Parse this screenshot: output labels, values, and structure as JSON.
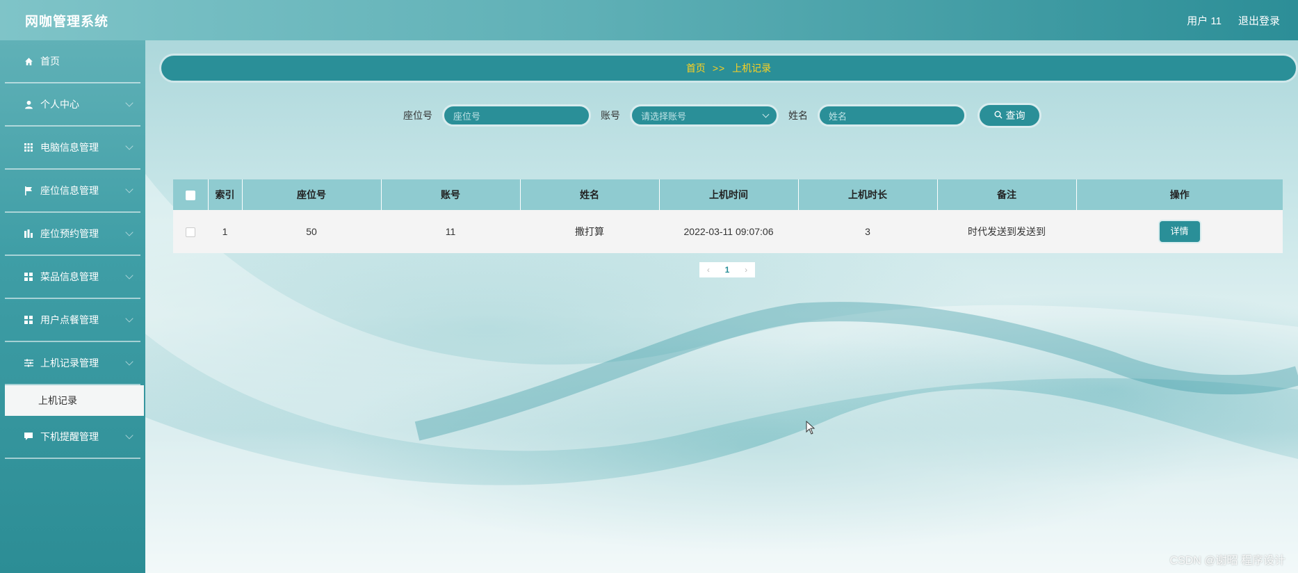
{
  "app": {
    "title": "网咖管理系统"
  },
  "header": {
    "user": "用户 11",
    "logout": "退出登录"
  },
  "sidebar": {
    "items": [
      {
        "label": "首页",
        "icon": "home-icon"
      },
      {
        "label": "个人中心",
        "icon": "user-icon"
      },
      {
        "label": "电脑信息管理",
        "icon": "grid-icon"
      },
      {
        "label": "座位信息管理",
        "icon": "flag-icon"
      },
      {
        "label": "座位预约管理",
        "icon": "chart-icon"
      },
      {
        "label": "菜品信息管理",
        "icon": "apps-icon"
      },
      {
        "label": "用户点餐管理",
        "icon": "apps-icon"
      },
      {
        "label": "上机记录管理",
        "icon": "sliders-icon"
      }
    ],
    "active_sub": "上机记录",
    "last_item": {
      "label": "下机提醒管理",
      "icon": "message-icon"
    }
  },
  "breadcrumb": {
    "home": "首页",
    "separator": ">>",
    "current": "上机记录"
  },
  "search": {
    "seat_label": "座位号",
    "seat_placeholder": "座位号",
    "account_label": "账号",
    "account_placeholder": "请选择账号",
    "name_label": "姓名",
    "name_placeholder": "姓名",
    "button": "查询"
  },
  "table": {
    "headers": [
      "索引",
      "座位号",
      "账号",
      "姓名",
      "上机时间",
      "上机时长",
      "备注",
      "操作"
    ],
    "rows": [
      {
        "index": "1",
        "seat": "50",
        "account": "11",
        "name": "撒打算",
        "time": "2022-03-11 09:07:06",
        "duration": "3",
        "note": "时代发送到发送到",
        "action": "详情"
      }
    ]
  },
  "pagination": {
    "current": "1"
  },
  "watermark": "CSDN @谢昭 程序设计",
  "colors": {
    "primary": "#2a8f98",
    "breadcrumb_text": "#ffd21f",
    "table_header": "#8fcbd0"
  }
}
